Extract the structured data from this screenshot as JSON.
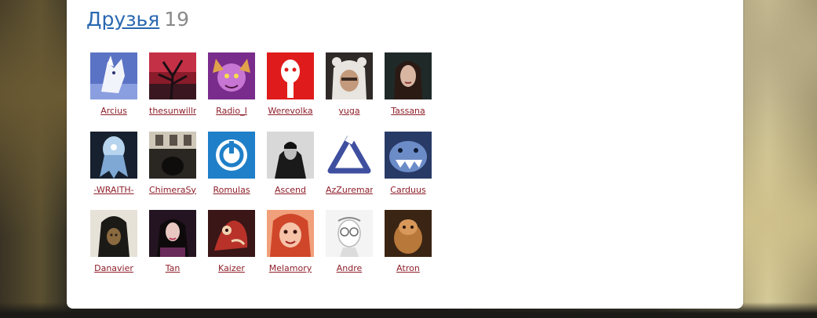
{
  "friends_section": {
    "title": "Друзья",
    "count": "19"
  },
  "friends": [
    {
      "name": "Arcius",
      "avatar": "white-dragon-avatar-icon"
    },
    {
      "name": "thesunwillne",
      "avatar": "dark-tree-avatar-icon"
    },
    {
      "name": "Radio_I",
      "avatar": "purple-character-avatar-icon"
    },
    {
      "name": "Werevolka",
      "avatar": "white-spirit-mask-avatar-icon"
    },
    {
      "name": "yuga",
      "avatar": "bear-hood-avatar-icon"
    },
    {
      "name": "Tassana",
      "avatar": "woman-portrait-avatar-icon"
    },
    {
      "name": "-WRAITH-",
      "avatar": "blue-ghost-avatar-icon"
    },
    {
      "name": "ChimeraSyb",
      "avatar": "dark-room-avatar-icon"
    },
    {
      "name": "Romulas",
      "avatar": "blue-power-logo-avatar-icon"
    },
    {
      "name": "Ascend",
      "avatar": "dark-figure-avatar-icon"
    },
    {
      "name": "AzZureman",
      "avatar": "triangle-logo-avatar-icon"
    },
    {
      "name": "Carduus",
      "avatar": "blue-monster-avatar-icon"
    },
    {
      "name": "Danavier",
      "avatar": "hooded-witch-avatar-icon"
    },
    {
      "name": "Tan",
      "avatar": "dark-hair-woman-avatar-icon"
    },
    {
      "name": "Kaizer",
      "avatar": "red-beast-avatar-icon"
    },
    {
      "name": "Melamory",
      "avatar": "red-hair-girl-avatar-icon"
    },
    {
      "name": "Andre",
      "avatar": "glasses-man-sketch-avatar-icon"
    },
    {
      "name": "Atron",
      "avatar": "bronze-creature-avatar-icon"
    }
  ]
}
